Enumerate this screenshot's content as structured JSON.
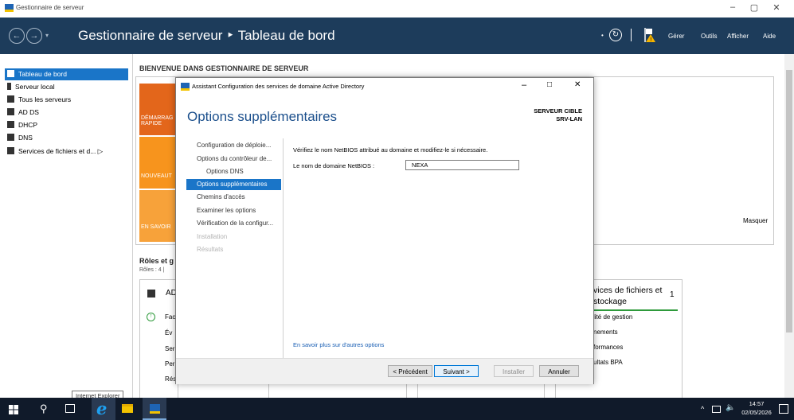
{
  "window": {
    "title": "Gestionnaire de serveur",
    "controls": [
      "–",
      "▢",
      "✕"
    ]
  },
  "header": {
    "title": "Gestionnaire de serveur ‣ Tableau de bord",
    "menu": [
      "Gérer",
      "Outils",
      "Afficher",
      "Aide"
    ]
  },
  "sidebar": {
    "items": [
      {
        "label": "Tableau de bord",
        "selected": true
      },
      {
        "label": "Serveur local"
      },
      {
        "label": "Tous les serveurs"
      },
      {
        "label": "AD DS"
      },
      {
        "label": "DHCP"
      },
      {
        "label": "DNS"
      },
      {
        "label": "Services de fichiers et d... ▷"
      }
    ]
  },
  "main": {
    "welcome_title": "BIENVENUE DANS GESTIONNAIRE DE SERVEUR",
    "tiles": [
      "DÉMARRAG RAPIDE",
      "NOUVEAUT",
      "EN SAVOIR"
    ],
    "hide_label": "Masquer",
    "roles_title": "Rôles et g",
    "roles_count": "Rôles : 4  |",
    "ad_card": {
      "title": "AD",
      "rows": [
        "Fac",
        "Év",
        "Ser",
        "Per",
        "Rés"
      ]
    },
    "files_card": {
      "title_line1": "vices de fichiers et",
      "title_line2": "stockage",
      "count": "1",
      "rows": [
        "lité de gestion",
        "nements",
        "formances",
        "ultats BPA"
      ]
    }
  },
  "dialog": {
    "title": "Assistant Configuration des services de domaine Active Directory",
    "heading": "Options supplémentaires",
    "target_label": "SERVEUR CIBLE",
    "target_value": "SRV-LAN",
    "steps": [
      {
        "label": "Configuration de déploie...",
        "state": "normal"
      },
      {
        "label": "Options du contrôleur de...",
        "state": "normal"
      },
      {
        "label": "Options DNS",
        "state": "normal"
      },
      {
        "label": "Options supplémentaires",
        "state": "selected"
      },
      {
        "label": "Chemins d'accès",
        "state": "normal"
      },
      {
        "label": "Examiner les options",
        "state": "normal"
      },
      {
        "label": "Vérification de la configur...",
        "state": "normal"
      },
      {
        "label": "Installation",
        "state": "disabled"
      },
      {
        "label": "Résultats",
        "state": "disabled"
      }
    ],
    "instruction": "Vérifiez le nom NetBIOS attribué au domaine et modifiez-le si nécessaire.",
    "netbios_label": "Le nom de domaine NetBIOS :",
    "netbios_value": "NEXA",
    "more_link": "En savoir plus sur d'autres options",
    "buttons": {
      "prev": "< Précédent",
      "next": "Suivant >",
      "install": "Installer",
      "cancel": "Annuler"
    }
  },
  "taskbar": {
    "tooltip": "Internet Explorer",
    "time": "14:57",
    "date": "02/05/2026"
  },
  "colors": {
    "header_bg": "#1d3c5b",
    "selection": "#1a75c8",
    "tile_orange": "#f7941d",
    "tile_dark_orange": "#e3661b",
    "link": "#1a5fb4"
  }
}
